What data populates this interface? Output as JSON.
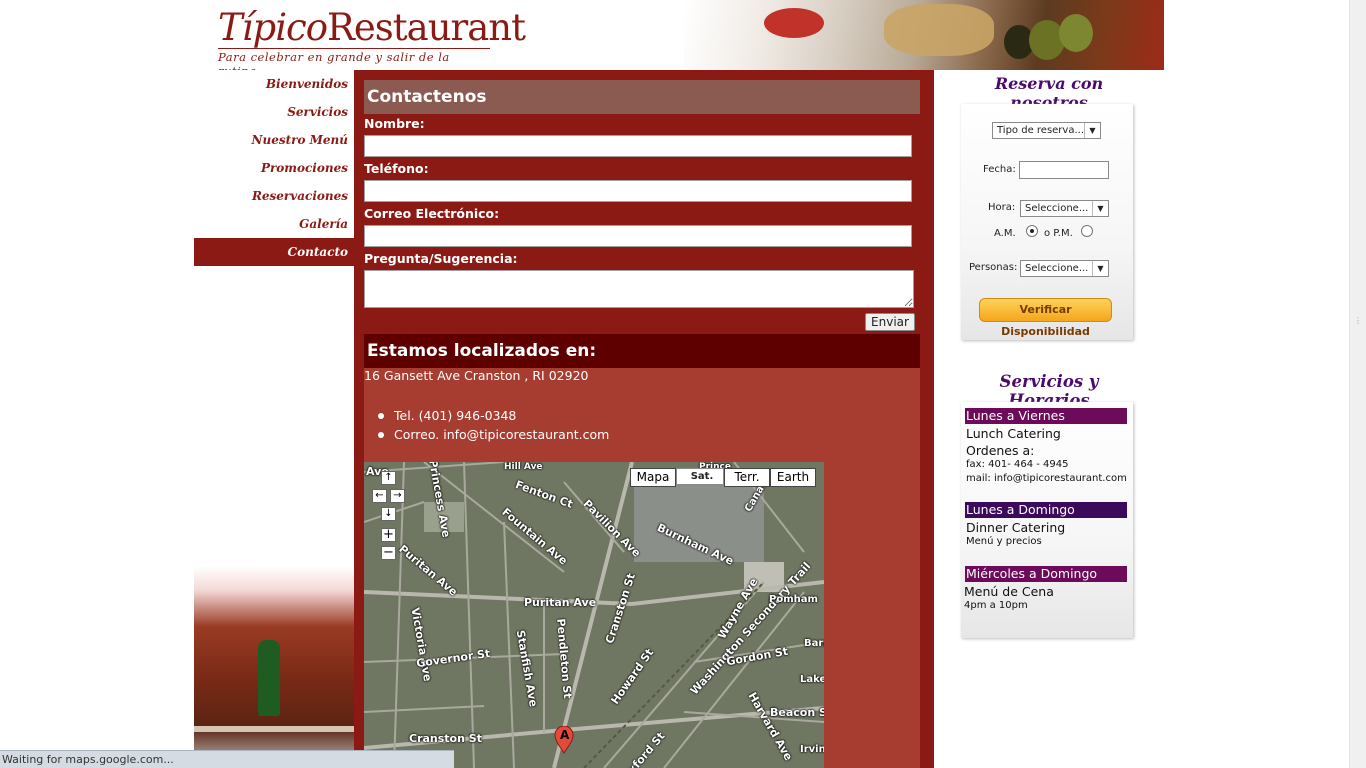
{
  "header": {
    "logo_part1": "Típico",
    "logo_part2": "Restaurant",
    "tagline": "Para celebrar en grande y salir de la rutina."
  },
  "nav": {
    "items": [
      {
        "label": "Bienvenidos",
        "active": false
      },
      {
        "label": "Servicios",
        "active": false
      },
      {
        "label": "Nuestro Menú",
        "active": false
      },
      {
        "label": "Promociones",
        "active": false
      },
      {
        "label": "Reservaciones",
        "active": false
      },
      {
        "label": "Galería",
        "active": false
      },
      {
        "label": "Contacto",
        "active": true
      }
    ]
  },
  "contact": {
    "title": "Contactenos",
    "name_label": "Nombre:",
    "phone_label": "Teléfono:",
    "email_label": "Correo Electrónico:",
    "question_label": "Pregunta/Sugerencia:",
    "name_value": "",
    "phone_value": "",
    "email_value": "",
    "question_value": "",
    "send_label": "Enviar"
  },
  "location": {
    "title": "Estamos localizados en:",
    "address": "16 Gansett Ave Cranston , RI 02920",
    "phone": "Tel. (401) 946-0348",
    "email": "Correo. info@tipicorestaurant.com"
  },
  "map": {
    "types": [
      "Mapa",
      "Sat.",
      "Terr.",
      "Earth"
    ],
    "selected_type": "Sat.",
    "pan_up": "↑",
    "pan_left": "←",
    "pan_right": "→",
    "pan_down": "↓",
    "zoom_in": "+",
    "zoom_out": "−",
    "marker_label": "A",
    "streets": [
      "Cranston St",
      "Puritan Ave",
      "Pavilion Ave",
      "Burnham Ave",
      "Fountain Ave",
      "Governor St",
      "Stanfish Ave",
      "Pendleton St",
      "Howard St",
      "Gordon St",
      "Beacon St",
      "Wayne Ave",
      "Victoria Ave",
      "Princess Ave",
      "Washington Secondary Trail",
      "Hill Ave",
      "Harvard Ave",
      "Lake",
      "Irvin",
      "Barr",
      "Pomham",
      "Canal",
      "Prince",
      "Fenton Ct",
      "Oxford St"
    ]
  },
  "reserve": {
    "title": "Reserva con nosotros",
    "type_select": "Tipo de reserva...",
    "date_label": "Fecha:",
    "date_value": "",
    "time_label": "Hora:",
    "time_select": "Seleccione...",
    "am_label": "A.M.",
    "pm_label": "o P.M.",
    "am_selected": true,
    "people_label": "Personas:",
    "people_select": "Seleccione...",
    "verify_label": "Verificar Disponibilidad"
  },
  "hours": {
    "title": "Servicios y Horarios",
    "blocks": [
      {
        "day": "Lunes a Viernes",
        "color": "#6e0a5a",
        "line1": "Lunch Catering",
        "line2": "Ordenes a:",
        "line3": "fax: 401- 464 - 4945",
        "line4": "mail: info@tipicorestaurant.com"
      },
      {
        "day": "Lunes a Domingo",
        "color": "#3c0a5a",
        "line1": "Dinner Catering",
        "line2": "Menú y precios"
      },
      {
        "day": "Miércoles a Domingo",
        "color": "#6e0a5a",
        "line1": "Menú de Cena",
        "line2": "4pm a 10pm"
      }
    ]
  },
  "status": {
    "text": "Waiting for maps.google.com..."
  },
  "colors": {
    "brand_red": "#8b1a14",
    "purple": "#4b0a6e",
    "dark_header": "#5e0000"
  }
}
